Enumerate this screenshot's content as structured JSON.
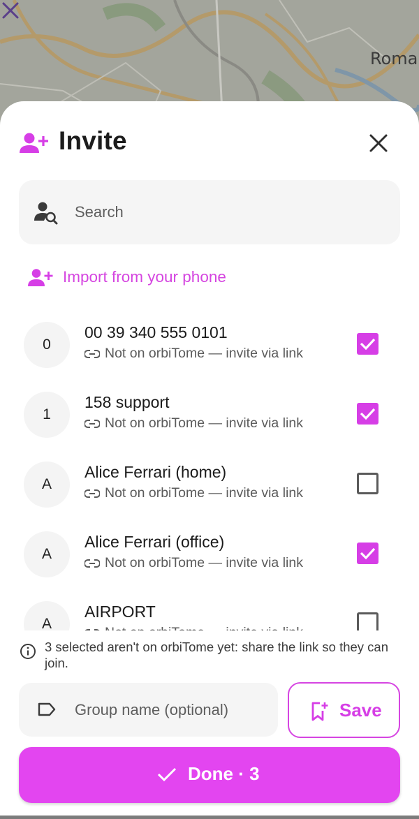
{
  "map": {
    "place_label": "Roma"
  },
  "header": {
    "title": "Invite"
  },
  "search": {
    "placeholder": "Search",
    "value": ""
  },
  "import": {
    "label": "Import from your phone"
  },
  "contacts": [
    {
      "initial": "0",
      "name": "00 39 340 555 0101",
      "status": "Not on orbiTome — invite via link",
      "checked": true
    },
    {
      "initial": "1",
      "name": "158 support",
      "status": "Not on orbiTome — invite via link",
      "checked": true
    },
    {
      "initial": "A",
      "name": "Alice Ferrari (home)",
      "status": "Not on orbiTome — invite via link",
      "checked": false
    },
    {
      "initial": "A",
      "name": "Alice Ferrari (office)",
      "status": "Not on orbiTome — invite via link",
      "checked": true
    },
    {
      "initial": "A",
      "name": "AIRPORT",
      "status": "Not on orbiTome — invite via link",
      "checked": false
    }
  ],
  "notice": {
    "text": "3 selected aren't on orbiTome yet: share the link so they can join."
  },
  "group": {
    "placeholder": "Group name (optional)",
    "value": ""
  },
  "save": {
    "label": "Save"
  },
  "done": {
    "label": "Done · 3"
  },
  "colors": {
    "accent": "#d63ee6",
    "done_bg": "#e345f0",
    "field_bg": "#f5f5f5"
  },
  "icons": {
    "header": "person-add-icon",
    "close": "close-icon",
    "search": "person-search-icon",
    "import": "person-add-icon",
    "status": "link-icon",
    "notice": "info-icon",
    "group": "label-icon",
    "save": "bookmark-add-icon",
    "done": "check-icon"
  }
}
